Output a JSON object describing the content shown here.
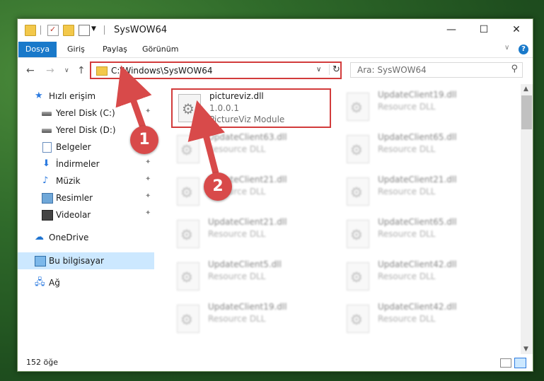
{
  "window": {
    "title": "SysWOW64",
    "controls": {
      "minimize": "—",
      "maximize": "☐",
      "close": "✕"
    }
  },
  "ribbon": {
    "tabs": [
      "Dosya",
      "Giriş",
      "Paylaş",
      "Görünüm"
    ],
    "help": "?"
  },
  "nav": {
    "address": "C:\\Windows\\SysWOW64",
    "search_placeholder": "Ara: SysWOW64"
  },
  "sidebar": {
    "items": [
      {
        "label": "Hızlı erişim",
        "icon": "star-icon"
      },
      {
        "label": "Yerel Disk (C:)",
        "icon": "disk-icon",
        "pinned": true
      },
      {
        "label": "Yerel Disk (D:)",
        "icon": "disk-icon"
      },
      {
        "label": "Belgeler",
        "icon": "documents-icon"
      },
      {
        "label": "İndirmeler",
        "icon": "download-icon",
        "pinned": true
      },
      {
        "label": "Müzik",
        "icon": "music-icon",
        "pinned": true
      },
      {
        "label": "Resimler",
        "icon": "pictures-icon",
        "pinned": true
      },
      {
        "label": "Videolar",
        "icon": "videos-icon",
        "pinned": true
      },
      {
        "label": "OneDrive",
        "icon": "cloud-icon"
      },
      {
        "label": "Bu bilgisayar",
        "icon": "computer-icon",
        "selected": true
      },
      {
        "label": "Ağ",
        "icon": "network-icon"
      }
    ]
  },
  "files": [
    {
      "name": "pictureviz.dll",
      "version": "1.0.0.1",
      "desc": "PictureViz Module",
      "highlighted": true
    },
    {
      "name": "UpdateClient19.dll",
      "desc": "Resource DLL"
    },
    {
      "name": "UpdateClient63.dll",
      "desc": "Resource DLL"
    },
    {
      "name": "UpdateClient65.dll",
      "desc": "Resource DLL"
    },
    {
      "name": "UpdateClient21.dll",
      "desc": "Resource DLL"
    },
    {
      "name": "UpdateClient21.dll",
      "desc": "Resource DLL"
    },
    {
      "name": "UpdateClient21.dll",
      "desc": "Resource DLL"
    },
    {
      "name": "UpdateClient65.dll",
      "desc": "Resource DLL"
    },
    {
      "name": "UpdateClient5.dll",
      "desc": "Resource DLL"
    },
    {
      "name": "UpdateClient42.dll",
      "desc": "Resource DLL"
    },
    {
      "name": "UpdateClient19.dll",
      "desc": "Resource DLL"
    },
    {
      "name": "UpdateClient42.dll",
      "desc": "Resource DLL"
    }
  ],
  "status": {
    "count": "152 öğe"
  },
  "callouts": [
    "1",
    "2"
  ],
  "colors": {
    "accent": "#1979ca",
    "highlight_red": "#d23b3b",
    "selection": "#cce8ff"
  }
}
